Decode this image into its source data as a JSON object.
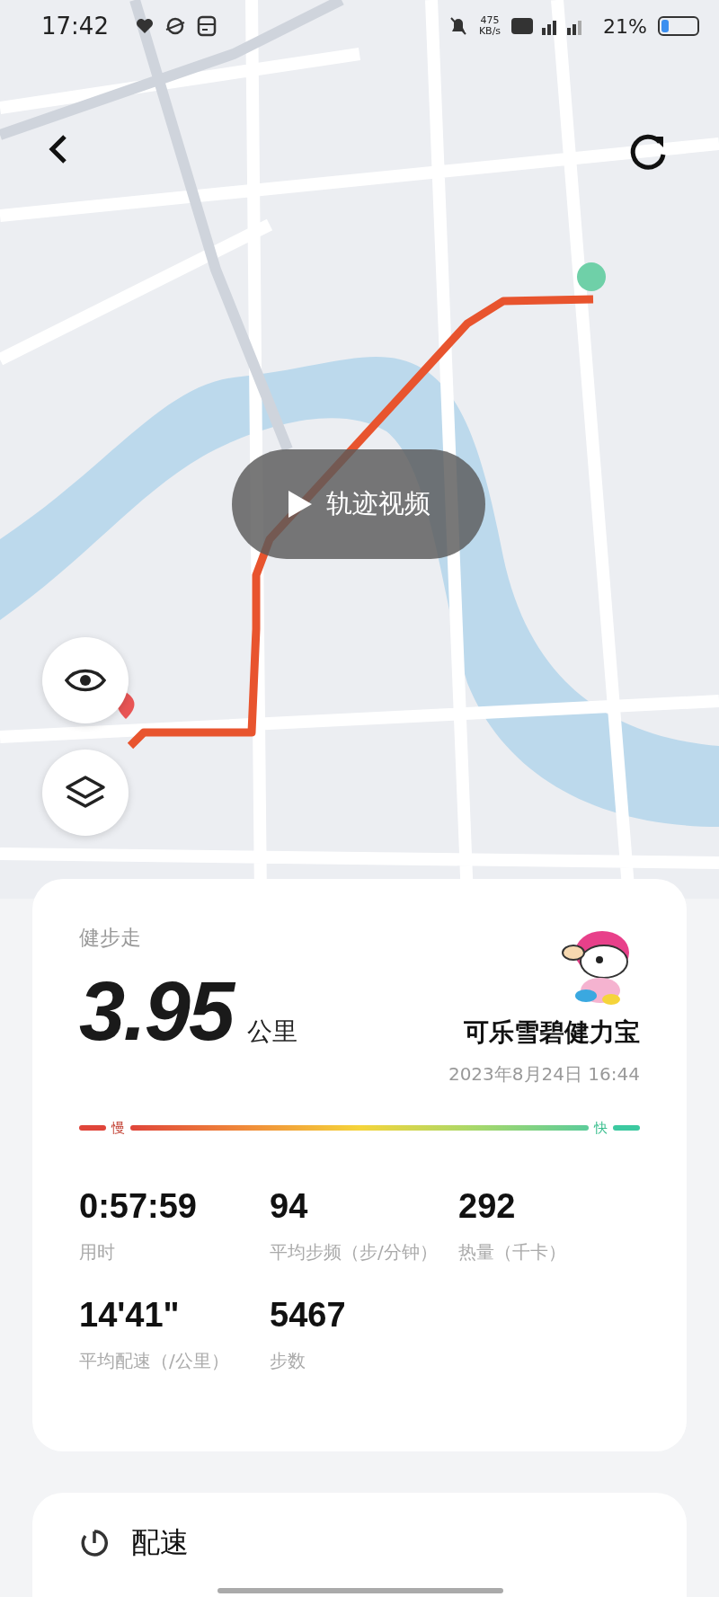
{
  "status_bar": {
    "time": "17:42",
    "net_speed": "475",
    "net_unit": "KB/s",
    "battery": "21%"
  },
  "map": {
    "video_button": "轨迹视频"
  },
  "summary": {
    "activity": "健步走",
    "distance": "3.95",
    "distance_unit": "公里",
    "brand": "可乐雪碧健力宝",
    "date": "2023年8月24日 16:44",
    "legend": {
      "slow": "慢",
      "fast": "快"
    },
    "stats": [
      {
        "value": "0:57:59",
        "label": "用时"
      },
      {
        "value": "94",
        "label": "平均步频（步/分钟）"
      },
      {
        "value": "292",
        "label": "热量（千卡）"
      },
      {
        "value": "14'41\"",
        "label": "平均配速（/公里）"
      },
      {
        "value": "5467",
        "label": "步数"
      }
    ]
  },
  "pace_section": {
    "title": "配速"
  }
}
